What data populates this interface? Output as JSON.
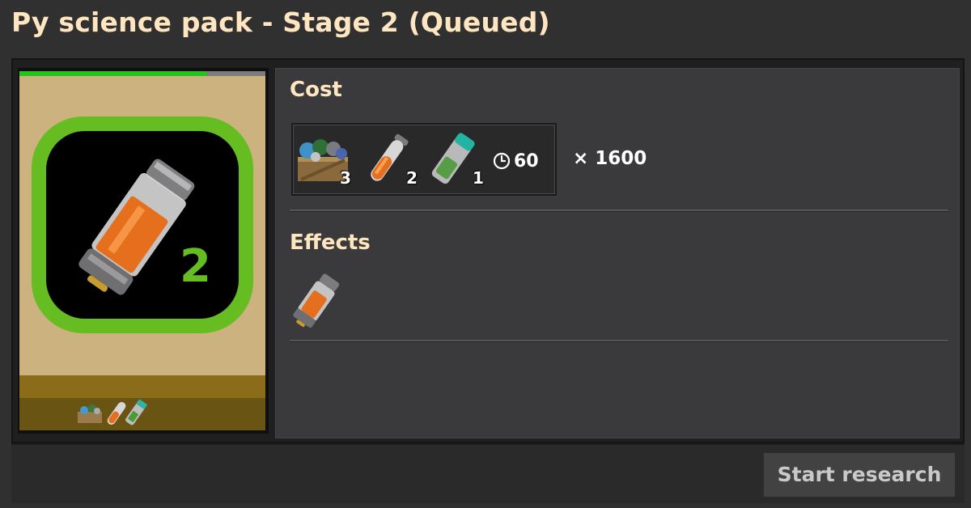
{
  "window": {
    "title": "Py science pack - Stage 2 (Queued)"
  },
  "technology": {
    "level_label": "2",
    "progress_fraction": 0.76,
    "icon": "py-science-pack-2-icon",
    "footer_icons": [
      "crate-icon",
      "orange-vial-icon",
      "green-battery-vial-icon"
    ]
  },
  "cost": {
    "label": "Cost",
    "ingredients": [
      {
        "icon": "crate-icon",
        "count": "3"
      },
      {
        "icon": "orange-vial-icon",
        "count": "2"
      },
      {
        "icon": "green-battery-vial-icon",
        "count": "1"
      }
    ],
    "time_icon": "clock-icon",
    "time": "60",
    "multiplier": "× 1600"
  },
  "effects": {
    "label": "Effects",
    "items": [
      {
        "icon": "py-science-pack-2-icon"
      }
    ]
  },
  "actions": {
    "start_research_label": "Start research"
  },
  "colors": {
    "title": "#ffe6c0",
    "progress": "#23c41c",
    "badge_ring": "#66bd22",
    "card_background": "#cbb27f"
  }
}
